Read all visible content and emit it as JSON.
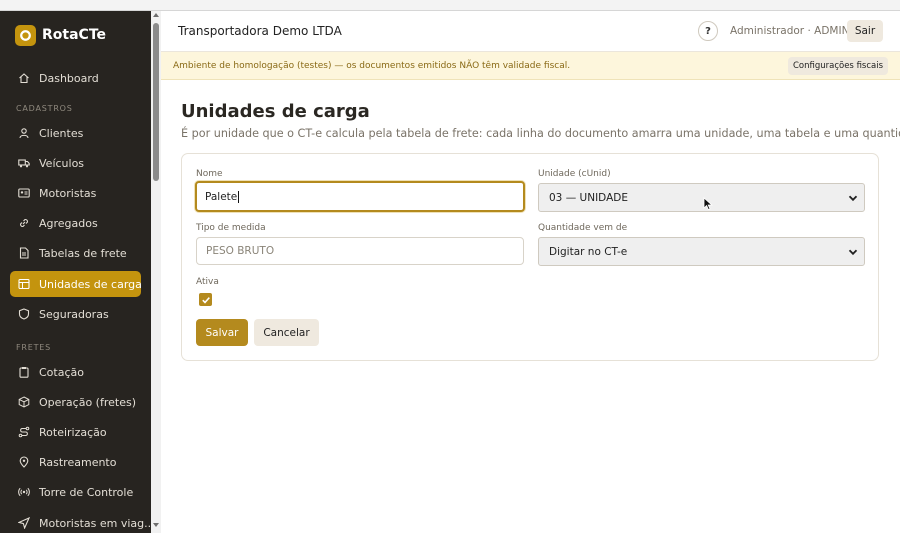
{
  "brand": {
    "name": "RotaCTe",
    "accent": "#c4940e"
  },
  "sidebar": {
    "items": [
      {
        "label": "Dashboard",
        "icon": "home-icon"
      },
      {
        "label": "Clientes",
        "icon": "user-icon"
      },
      {
        "label": "Veículos",
        "icon": "truck-icon"
      },
      {
        "label": "Motoristas",
        "icon": "id-card-icon"
      },
      {
        "label": "Agregados",
        "icon": "link-icon"
      },
      {
        "label": "Tabelas de frete",
        "icon": "document-icon"
      },
      {
        "label": "Unidades de carga",
        "icon": "table-icon",
        "active": true
      },
      {
        "label": "Seguradoras",
        "icon": "shield-icon"
      },
      {
        "label": "Cotação",
        "icon": "clipboard-icon"
      },
      {
        "label": "Operação (fretes)",
        "icon": "box-icon"
      },
      {
        "label": "Roteirização",
        "icon": "route-icon"
      },
      {
        "label": "Rastreamento",
        "icon": "pin-icon"
      },
      {
        "label": "Torre de Controle",
        "icon": "broadcast-icon"
      },
      {
        "label": "Motoristas em viag...",
        "icon": "navigation-icon"
      }
    ],
    "sections": {
      "cadastros": "CADASTROS",
      "fretes": "FRETES"
    }
  },
  "header": {
    "company": "Transportadora Demo LTDA",
    "help": "?",
    "user": "Administrador · ADMIN",
    "logout": "Sair"
  },
  "banner": {
    "text": "Ambiente de homologação (testes) — os documentos emitidos NÃO têm validade fiscal.",
    "button": "Configurações fiscais"
  },
  "page": {
    "title": "Unidades de carga",
    "subtitle": "É por unidade que o CT-e calcula pela tabela de frete: cada linha do documento amarra uma unidade, uma tabela e uma quantidade."
  },
  "form": {
    "nome_label": "Nome",
    "nome_value": "Palete",
    "unidade_label": "Unidade (cUnid)",
    "unidade_value": "03 — UNIDADE",
    "tipo_label": "Tipo de medida",
    "tipo_placeholder": "PESO BRUTO",
    "quantidade_label": "Quantidade vem de",
    "quantidade_value": "Digitar no CT-e",
    "ativa_label": "Ativa",
    "ativa_checked": true,
    "save": "Salvar",
    "cancel": "Cancelar"
  }
}
